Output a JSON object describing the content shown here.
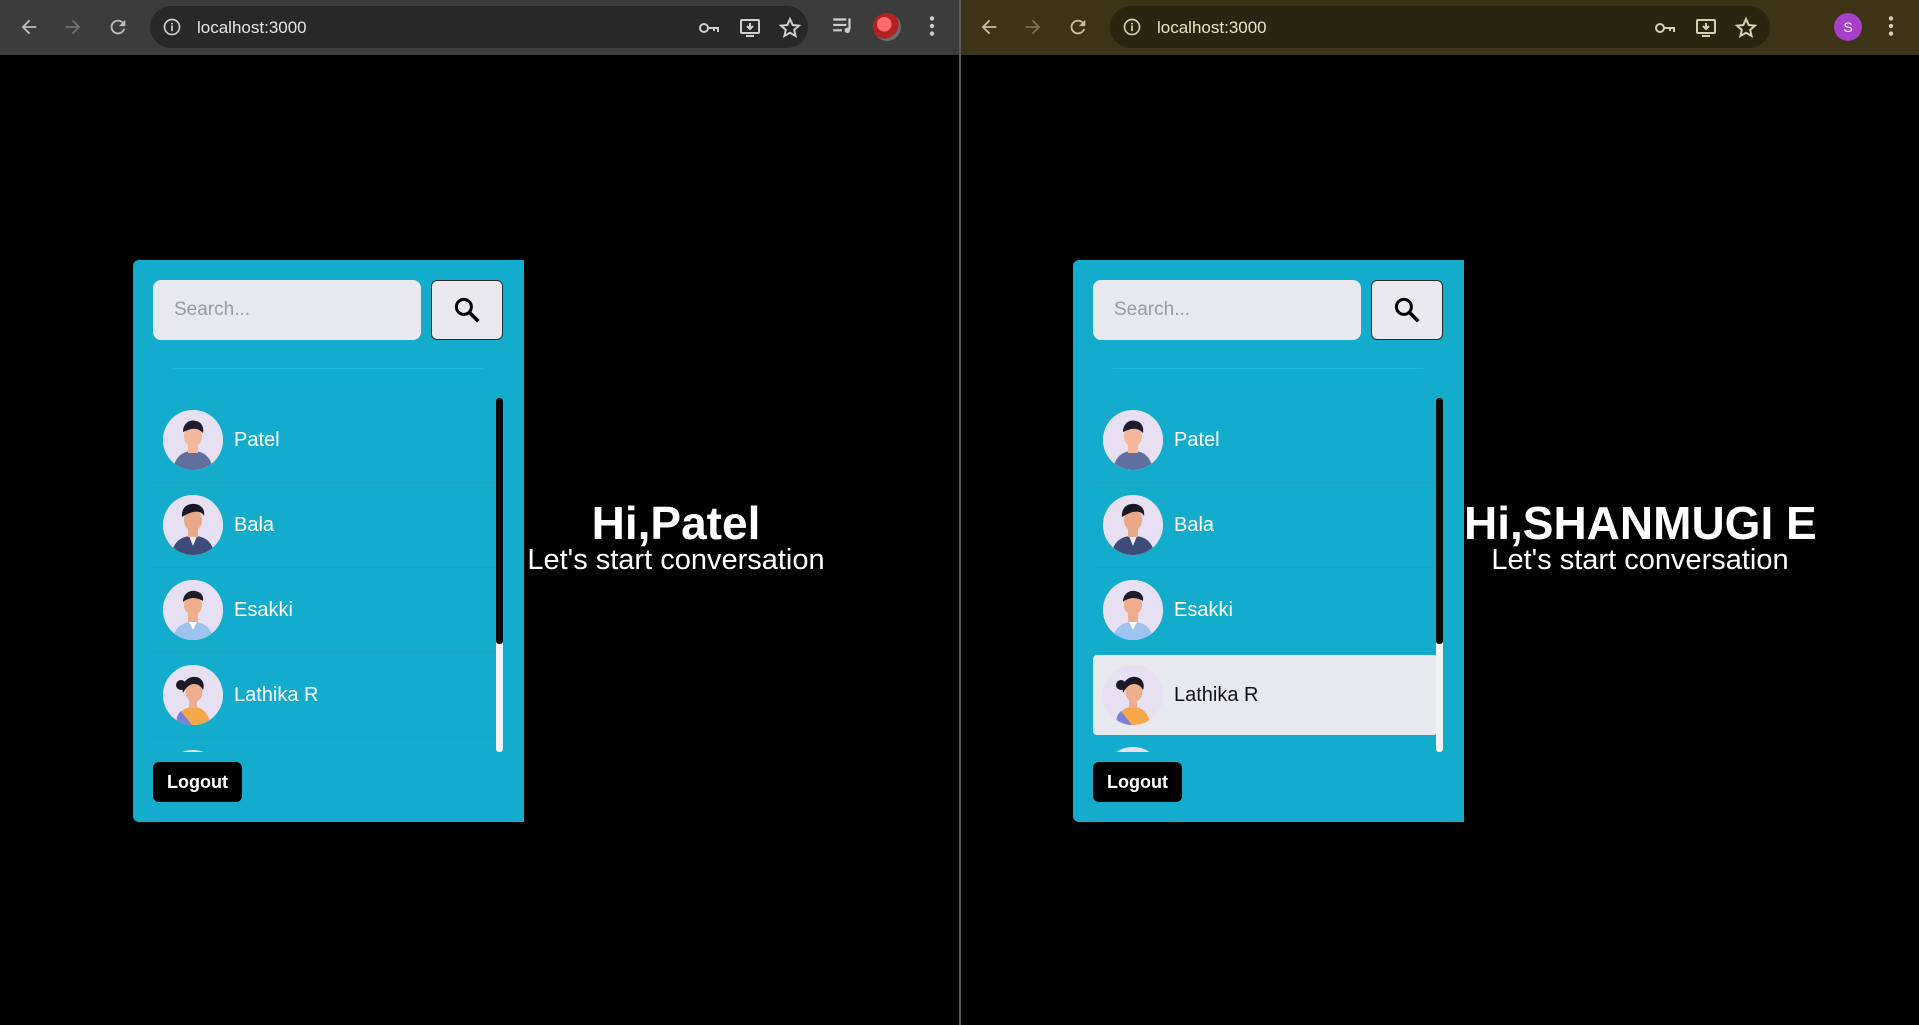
{
  "windows": [
    {
      "url": "localhost:3000",
      "profile_letter": "",
      "search_placeholder": "Search...",
      "users": [
        {
          "name": "Patel",
          "avatar": "man-avatar-1"
        },
        {
          "name": "Bala",
          "avatar": "man-avatar-2"
        },
        {
          "name": "Esakki",
          "avatar": "man-avatar-3"
        },
        {
          "name": "Lathika R",
          "avatar": "woman-avatar"
        }
      ],
      "selected_index": null,
      "logout_label": "Logout",
      "greeting": "Hi,Patel",
      "subtitle": "Let's start conversation"
    },
    {
      "url": "localhost:3000",
      "profile_letter": "S",
      "search_placeholder": "Search...",
      "users": [
        {
          "name": "Patel",
          "avatar": "man-avatar-1"
        },
        {
          "name": "Bala",
          "avatar": "man-avatar-2"
        },
        {
          "name": "Esakki",
          "avatar": "man-avatar-3"
        },
        {
          "name": "Lathika R",
          "avatar": "woman-avatar"
        }
      ],
      "selected_index": 3,
      "logout_label": "Logout",
      "greeting": "Hi,SHANMUGI E",
      "subtitle": "Let's start conversation"
    }
  ],
  "colors": {
    "panel": "#14accc",
    "toolbar_left": "#3c3c3c",
    "toolbar_right": "#3d3418",
    "selected_row": "#e8e8ef",
    "background": "#000000"
  }
}
